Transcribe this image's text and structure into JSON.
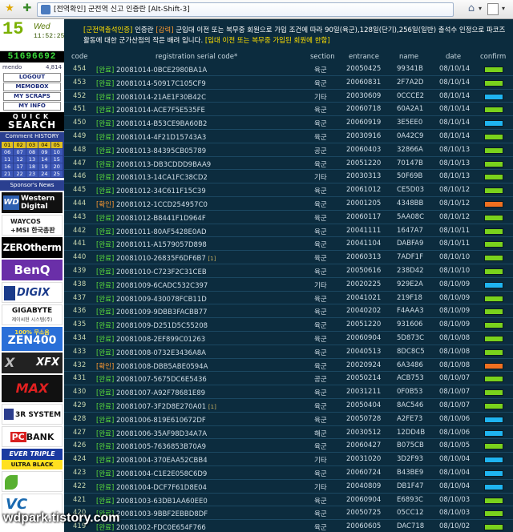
{
  "browser": {
    "tab_title": "[전역확인] 군전역 신고 인증란 [Alt-Shift-3]"
  },
  "sidebar": {
    "clock_day": "15",
    "clock_weekday": "Wed",
    "clock_time": "11:52:25",
    "counter": "51696692",
    "member_label": "mendo",
    "member_count": "4,814",
    "menu": [
      "LOGOUT",
      "MEMOBOX",
      "MY SCRAPS",
      "MY INFO"
    ],
    "quick_top": "QUICK",
    "quick_bottom": "SEARCH",
    "comment_history_label": "Comment HISTORY",
    "comment_days": [
      "01",
      "02",
      "03",
      "04",
      "05",
      "06",
      "07",
      "08",
      "09",
      "10",
      "11",
      "12",
      "13",
      "14",
      "15",
      "16",
      "17",
      "18",
      "19",
      "20",
      "21",
      "22",
      "23",
      "24",
      "25"
    ],
    "comment_highlight": [
      "01",
      "02",
      "03",
      "04",
      "05"
    ],
    "sponsors_label": "Sponsor's News",
    "ads": {
      "wd_line1": "Western",
      "wd_line2": "Digital",
      "wd_box": "WD",
      "waycos_line1": "WAYCOS",
      "waycos_line2": "+MSI 한국총판",
      "zero": "ZEROtherm",
      "benq": "BenQ",
      "digix": "DIGIX",
      "giga": "GIGABYTE",
      "giga_sub": "제이씨현 시스템(주)",
      "zen_top": "100% 무소음",
      "zen": "ZEN400",
      "xfx_x": "X",
      "xfx": "XFX",
      "max": "MAX",
      "rsys": "3R SYSTEM",
      "pcbank_a": "PC",
      "pcbank_b": "BANK",
      "ever": "EVER TRIPLE",
      "ever_sub": "ULTRA BLACK",
      "vc": "VC"
    }
  },
  "notice": {
    "tag": "[군전역출석인증]",
    "text1": "인증란 ",
    "tag2": "[감력]",
    "text2": "군입대 이전 또는 복무중 회원으로 가입 조건에 따라 90일(육군),128일(단기),256일(일반) 출석수 인정으로 파코즈 활동에 대한 군가산점의 작은 배려 입니다.",
    "tag3": "[입대 이전 또는 복무중 가입된 회원에 한함]"
  },
  "columns": {
    "code": "code",
    "reg": "registration serial code*",
    "section": "section",
    "entrance": "entrance",
    "name": "name",
    "date": "date",
    "confirm": "confirm"
  },
  "status_colors": {
    "green": "#7ad21c",
    "blue": "#1fb4f0",
    "orange": "#f07020"
  },
  "rows": [
    {
      "code": "454",
      "status": "[완료]",
      "serial": "20081014-0BCE2980BA1A",
      "note": "",
      "section": "육군",
      "entrance": "20050425",
      "name": "99341B",
      "date": "08/10/14",
      "confirm": "green"
    },
    {
      "code": "453",
      "status": "[완료]",
      "serial": "20081014-50917C105CF9",
      "note": "",
      "section": "육군",
      "entrance": "20060831",
      "name": "2F7A2D",
      "date": "08/10/14",
      "confirm": "green"
    },
    {
      "code": "452",
      "status": "[완료]",
      "serial": "20081014-21AE1F30B42C",
      "note": "",
      "section": "기타",
      "entrance": "20030609",
      "name": "0CCCE2",
      "date": "08/10/14",
      "confirm": "blue"
    },
    {
      "code": "451",
      "status": "[완료]",
      "serial": "20081014-ACE7F5E535FE",
      "note": "",
      "section": "육군",
      "entrance": "20060718",
      "name": "60A2A1",
      "date": "08/10/14",
      "confirm": "green"
    },
    {
      "code": "450",
      "status": "[완료]",
      "serial": "20081014-B53CE9BA60B2",
      "note": "",
      "section": "육군",
      "entrance": "20060919",
      "name": "3E5EE0",
      "date": "08/10/14",
      "confirm": "blue"
    },
    {
      "code": "449",
      "status": "[완료]",
      "serial": "20081014-4F21D15743A3",
      "note": "",
      "section": "육군",
      "entrance": "20030916",
      "name": "0A42C9",
      "date": "08/10/14",
      "confirm": "green"
    },
    {
      "code": "448",
      "status": "[완료]",
      "serial": "20081013-84395CB05789",
      "note": "",
      "section": "공군",
      "entrance": "20060403",
      "name": "32866A",
      "date": "08/10/13",
      "confirm": "green"
    },
    {
      "code": "447",
      "status": "[완료]",
      "serial": "20081013-DB3CDDD9BAA9",
      "note": "",
      "section": "육군",
      "entrance": "20051220",
      "name": "70147B",
      "date": "08/10/13",
      "confirm": "green"
    },
    {
      "code": "446",
      "status": "[완료]",
      "serial": "20081013-14CA1FC38CD2",
      "note": "",
      "section": "기타",
      "entrance": "20030313",
      "name": "50F69B",
      "date": "08/10/13",
      "confirm": "green"
    },
    {
      "code": "445",
      "status": "[완료]",
      "serial": "20081012-34C611F15C39",
      "note": "",
      "section": "육군",
      "entrance": "20061012",
      "name": "CE5D03",
      "date": "08/10/12",
      "confirm": "green"
    },
    {
      "code": "444",
      "status": "[확인]",
      "serial": "20081012-1CCD254957C0",
      "note": "",
      "section": "육군",
      "entrance": "20001205",
      "name": "4348BB",
      "date": "08/10/12",
      "confirm": "orange"
    },
    {
      "code": "443",
      "status": "[완료]",
      "serial": "20081012-B8441F1D964F",
      "note": "",
      "section": "육군",
      "entrance": "20060117",
      "name": "5AA08C",
      "date": "08/10/12",
      "confirm": "green"
    },
    {
      "code": "442",
      "status": "[완료]",
      "serial": "20081011-80AF5428E0AD",
      "note": "",
      "section": "육군",
      "entrance": "20041111",
      "name": "1647A7",
      "date": "08/10/11",
      "confirm": "green"
    },
    {
      "code": "441",
      "status": "[완료]",
      "serial": "20081011-A1579057D898",
      "note": "",
      "section": "육군",
      "entrance": "20041104",
      "name": "DABFA9",
      "date": "08/10/11",
      "confirm": "green"
    },
    {
      "code": "440",
      "status": "[완료]",
      "serial": "20081010-26835F6DF6B7",
      "note": "[1]",
      "section": "육군",
      "entrance": "20060313",
      "name": "7ADF1F",
      "date": "08/10/10",
      "confirm": "green"
    },
    {
      "code": "439",
      "status": "[완료]",
      "serial": "20081010-C723F2C31CEB",
      "note": "",
      "section": "육군",
      "entrance": "20050616",
      "name": "238D42",
      "date": "08/10/10",
      "confirm": "green"
    },
    {
      "code": "438",
      "status": "[완료]",
      "serial": "20081009-6CADC532C397",
      "note": "",
      "section": "기타",
      "entrance": "20020225",
      "name": "929E2A",
      "date": "08/10/09",
      "confirm": "blue"
    },
    {
      "code": "437",
      "status": "[완료]",
      "serial": "20081009-430078FCB11D",
      "note": "",
      "section": "육군",
      "entrance": "20041021",
      "name": "219F18",
      "date": "08/10/09",
      "confirm": "green"
    },
    {
      "code": "436",
      "status": "[완료]",
      "serial": "20081009-9DBB3FACBB77",
      "note": "",
      "section": "육군",
      "entrance": "20040202",
      "name": "F4AAA3",
      "date": "08/10/09",
      "confirm": "green"
    },
    {
      "code": "435",
      "status": "[완료]",
      "serial": "20081009-D251D5C55208",
      "note": "",
      "section": "육군",
      "entrance": "20051220",
      "name": "931606",
      "date": "08/10/09",
      "confirm": "green"
    },
    {
      "code": "434",
      "status": "[완료]",
      "serial": "20081008-2EF899C01263",
      "note": "",
      "section": "육군",
      "entrance": "20060904",
      "name": "5D873C",
      "date": "08/10/08",
      "confirm": "green"
    },
    {
      "code": "433",
      "status": "[완료]",
      "serial": "20081008-0732E3436A8A",
      "note": "",
      "section": "육군",
      "entrance": "20040513",
      "name": "8DC8C5",
      "date": "08/10/08",
      "confirm": "green"
    },
    {
      "code": "432",
      "status": "[확인]",
      "serial": "20081008-DBB5ABE0594A",
      "note": "",
      "section": "육군",
      "entrance": "20020924",
      "name": "6A3486",
      "date": "08/10/08",
      "confirm": "orange"
    },
    {
      "code": "431",
      "status": "[완료]",
      "serial": "20081007-5675DC6E5436",
      "note": "",
      "section": "공군",
      "entrance": "20050214",
      "name": "ACB753",
      "date": "08/10/07",
      "confirm": "green"
    },
    {
      "code": "430",
      "status": "[완료]",
      "serial": "20081007-A92F78681E89",
      "note": "",
      "section": "육군",
      "entrance": "20031211",
      "name": "0F0B53",
      "date": "08/10/07",
      "confirm": "green"
    },
    {
      "code": "429",
      "status": "[완료]",
      "serial": "20081007-3F2D8E270A01",
      "note": "[1]",
      "section": "육군",
      "entrance": "20050404",
      "name": "8AC546",
      "date": "08/10/07",
      "confirm": "green"
    },
    {
      "code": "428",
      "status": "[완료]",
      "serial": "20081006-819E610672DF",
      "note": "",
      "section": "육군",
      "entrance": "20050728",
      "name": "A2FE73",
      "date": "08/10/06",
      "confirm": "blue"
    },
    {
      "code": "427",
      "status": "[완료]",
      "serial": "20081006-35AF98D34A7A",
      "note": "",
      "section": "해군",
      "entrance": "20030512",
      "name": "12DD4B",
      "date": "08/10/06",
      "confirm": "blue"
    },
    {
      "code": "426",
      "status": "[완료]",
      "serial": "20081005-7636853B70A9",
      "note": "",
      "section": "육군",
      "entrance": "20060427",
      "name": "B075CB",
      "date": "08/10/05",
      "confirm": "green"
    },
    {
      "code": "424",
      "status": "[완료]",
      "serial": "20081004-370EAA52CBB4",
      "note": "",
      "section": "기타",
      "entrance": "20031020",
      "name": "3D2F93",
      "date": "08/10/04",
      "confirm": "blue"
    },
    {
      "code": "423",
      "status": "[완료]",
      "serial": "20081004-C1E2E058C6D9",
      "note": "",
      "section": "육군",
      "entrance": "20060724",
      "name": "B43BE9",
      "date": "08/10/04",
      "confirm": "blue"
    },
    {
      "code": "422",
      "status": "[완료]",
      "serial": "20081004-DCF7F61D8E04",
      "note": "",
      "section": "기타",
      "entrance": "20040809",
      "name": "DB1F47",
      "date": "08/10/04",
      "confirm": "blue"
    },
    {
      "code": "421",
      "status": "[완료]",
      "serial": "20081003-63DB1AA60EE0",
      "note": "",
      "section": "육군",
      "entrance": "20060904",
      "name": "E6893C",
      "date": "08/10/03",
      "confirm": "green"
    },
    {
      "code": "420",
      "status": "[완료]",
      "serial": "20081003-9BBF2EBBD8DF",
      "note": "",
      "section": "육군",
      "entrance": "20050725",
      "name": "05CC12",
      "date": "08/10/03",
      "confirm": "green"
    },
    {
      "code": "419",
      "status": "[완료]",
      "serial": "20081002-FDC0E654F766",
      "note": "",
      "section": "육군",
      "entrance": "20060605",
      "name": "DAC718",
      "date": "08/10/02",
      "confirm": "green"
    }
  ],
  "watermark": "wdpark.tistory.com"
}
